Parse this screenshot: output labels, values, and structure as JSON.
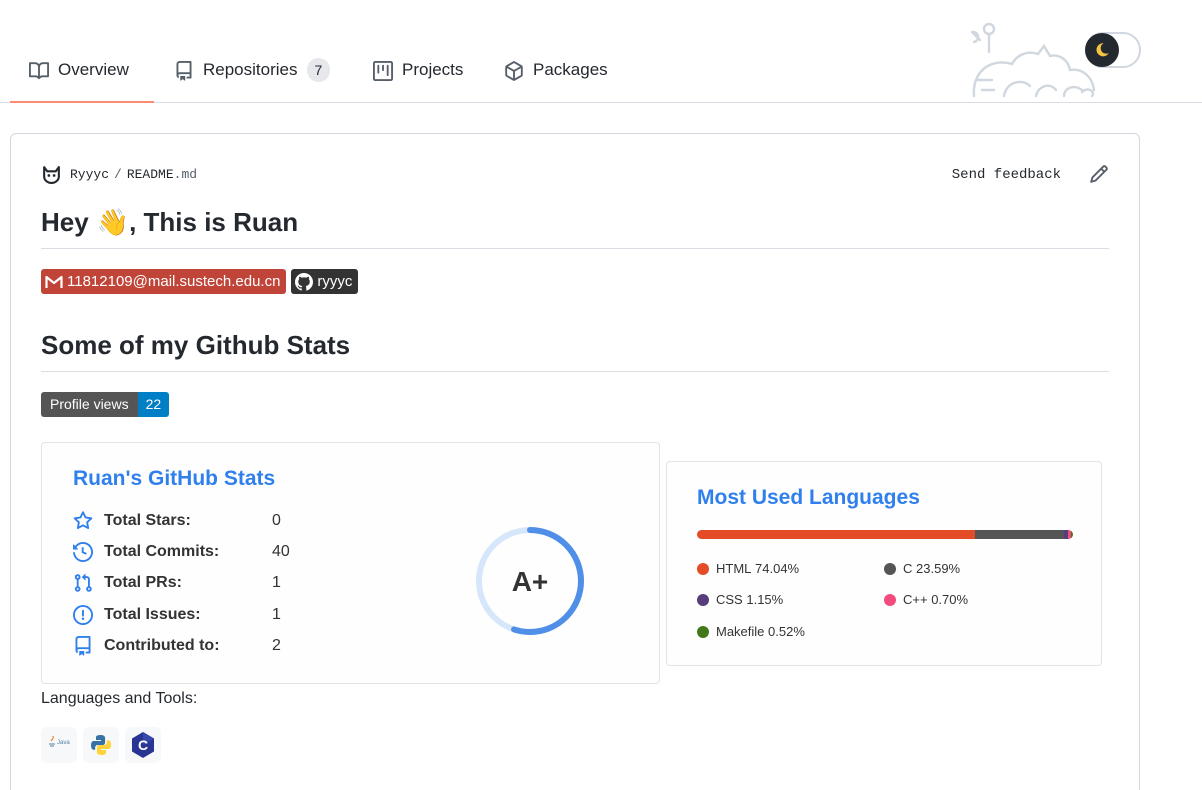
{
  "tabs": [
    {
      "label": "Overview",
      "icon": "book-icon",
      "active": true
    },
    {
      "label": "Repositories",
      "icon": "repo-icon",
      "count": "7"
    },
    {
      "label": "Projects",
      "icon": "project-icon"
    },
    {
      "label": "Packages",
      "icon": "package-icon"
    }
  ],
  "readme": {
    "user": "Ryyyc",
    "separator": "/",
    "file_base": "README",
    "file_ext": ".md",
    "feedback": "Send feedback",
    "heading": "Hey",
    "wave": "👋",
    "heading_rest": ", This is Ruan",
    "email": "11812109@mail.sustech.edu.cn",
    "github": "ryyyc",
    "stats_heading": "Some of my Github Stats",
    "views_label": "Profile views",
    "views_count": "22",
    "languages_tools": "Languages and Tools:"
  },
  "stats": {
    "title": "Ruan's GitHub Stats",
    "rows": [
      {
        "label": "Total Stars:",
        "value": "0",
        "icon": "star-icon"
      },
      {
        "label": "Total Commits:",
        "value": "40",
        "icon": "history-icon"
      },
      {
        "label": "Total PRs:",
        "value": "1",
        "icon": "pull-request-icon"
      },
      {
        "label": "Total Issues:",
        "value": "1",
        "icon": "issue-icon"
      },
      {
        "label": "Contributed to:",
        "value": "2",
        "icon": "repo-icon"
      }
    ],
    "rank": "A+",
    "rank_progress": 0.55,
    "accent": "#2f80ed"
  },
  "languages": {
    "title": "Most Used Languages",
    "items": [
      {
        "name": "HTML",
        "percent": "74.04%",
        "value": 74.04,
        "color": "#e34c26"
      },
      {
        "name": "C",
        "percent": "23.59%",
        "value": 23.59,
        "color": "#555555"
      },
      {
        "name": "CSS",
        "percent": "1.15%",
        "value": 1.15,
        "color": "#563d7c"
      },
      {
        "name": "C++",
        "percent": "0.70%",
        "value": 0.7,
        "color": "#f34b7d"
      },
      {
        "name": "Makefile",
        "percent": "0.52%",
        "value": 0.52,
        "color": "#427819"
      }
    ]
  },
  "tools": [
    {
      "name": "java-logo",
      "text": "Java"
    },
    {
      "name": "python-logo"
    },
    {
      "name": "c-logo",
      "text": "C"
    }
  ],
  "theme_toggle": {
    "icon": "moon-icon"
  }
}
